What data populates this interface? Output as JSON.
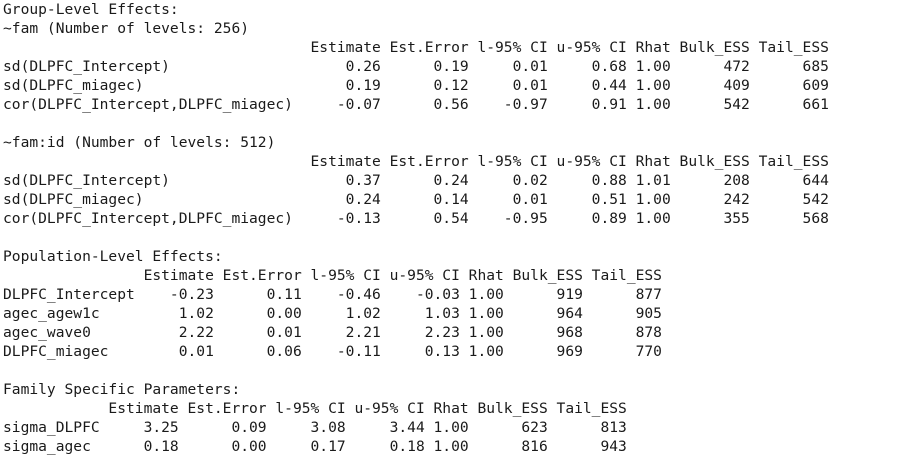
{
  "sections": {
    "group_header": "Group-Level Effects:",
    "fam": {
      "title": "~fam (Number of levels: 256)",
      "header": "                                   Estimate Est.Error l-95% CI u-95% CI Rhat Bulk_ESS Tail_ESS",
      "rows": [
        "sd(DLPFC_Intercept)                    0.26      0.19     0.01     0.68 1.00      472      685",
        "sd(DLPFC_miagec)                       0.19      0.12     0.01     0.44 1.00      409      609",
        "cor(DLPFC_Intercept,DLPFC_miagec)     -0.07      0.56    -0.97     0.91 1.00      542      661"
      ]
    },
    "famid": {
      "title": "~fam:id (Number of levels: 512)",
      "header": "                                   Estimate Est.Error l-95% CI u-95% CI Rhat Bulk_ESS Tail_ESS",
      "rows": [
        "sd(DLPFC_Intercept)                    0.37      0.24     0.02     0.88 1.01      208      644",
        "sd(DLPFC_miagec)                       0.24      0.14     0.01     0.51 1.00      242      542",
        "cor(DLPFC_Intercept,DLPFC_miagec)     -0.13      0.54    -0.95     0.89 1.00      355      568"
      ]
    },
    "population": {
      "title": "Population-Level Effects:",
      "header": "                Estimate Est.Error l-95% CI u-95% CI Rhat Bulk_ESS Tail_ESS",
      "rows": [
        "DLPFC_Intercept    -0.23      0.11    -0.46    -0.03 1.00      919      877",
        "agec_agew1c         1.02      0.00     1.02     1.03 1.00      964      905",
        "agec_wave0          2.22      0.01     2.21     2.23 1.00      968      878",
        "DLPFC_miagec        0.01      0.06    -0.11     0.13 1.00      969      770"
      ]
    },
    "family": {
      "title": "Family Specific Parameters:",
      "header": "            Estimate Est.Error l-95% CI u-95% CI Rhat Bulk_ESS Tail_ESS",
      "rows": [
        "sigma_DLPFC     3.25      0.09     3.08     3.44 1.00      623      813",
        "sigma_agec      0.18      0.00     0.17     0.18 1.00      816      943"
      ]
    }
  }
}
